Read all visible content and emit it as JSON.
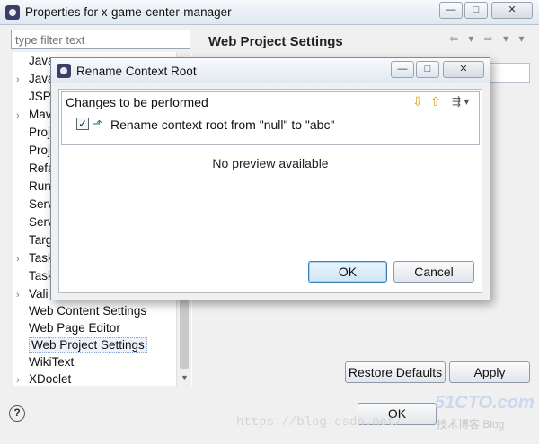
{
  "window": {
    "title": "Properties for x-game-center-manager",
    "minimize_glyph": "—",
    "maximize_glyph": "□",
    "close_glyph": "✕",
    "icon": "eclipse-icon"
  },
  "filter": {
    "placeholder": "type filter text"
  },
  "tree": {
    "items": [
      {
        "label": "Java",
        "arrow": ""
      },
      {
        "label": "Java",
        "arrow": "›"
      },
      {
        "label": "JSP",
        "arrow": ""
      },
      {
        "label": "Mav",
        "arrow": "›"
      },
      {
        "label": "Proj",
        "arrow": ""
      },
      {
        "label": "Proj",
        "arrow": ""
      },
      {
        "label": "Refa",
        "arrow": ""
      },
      {
        "label": "Run",
        "arrow": ""
      },
      {
        "label": "Serv",
        "arrow": ""
      },
      {
        "label": "Serv",
        "arrow": ""
      },
      {
        "label": "Targ",
        "arrow": ""
      },
      {
        "label": "Task",
        "arrow": "›"
      },
      {
        "label": "Task",
        "arrow": ""
      },
      {
        "label": "Vali",
        "arrow": "›"
      },
      {
        "label": "Web Content Settings",
        "arrow": ""
      },
      {
        "label": "Web Page Editor",
        "arrow": ""
      },
      {
        "label": "Web Project Settings",
        "arrow": "",
        "selected": true
      },
      {
        "label": "WikiText",
        "arrow": ""
      },
      {
        "label": "XDoclet",
        "arrow": "›"
      }
    ]
  },
  "right_panel": {
    "title": "Web Project Settings",
    "nav_glyphs": "⇦ ▾ ⇨ ▾ ▾",
    "restore_defaults_label": "Restore Defaults",
    "apply_label": "Apply"
  },
  "footer": {
    "help_glyph": "?",
    "ok_label": "OK",
    "watermark": "https://blog.csdn.net/",
    "logo_text": "51CTO.com",
    "logo_sub": "技术博客 Blog"
  },
  "dialog": {
    "title": "Rename Context Root",
    "minimize_glyph": "—",
    "maximize_glyph": "□",
    "close_glyph": "✕",
    "changes_header": "Changes to be performed",
    "toolbar_down_glyph": "⇩",
    "toolbar_up_glyph": "⇧",
    "toolbar_filter_glyph": "⇶ ▾",
    "change_checked_glyph": "✓",
    "change_text": "Rename context root from \"null\" to \"abc\"",
    "no_preview": "No preview available",
    "ok_label": "OK",
    "cancel_label": "Cancel"
  }
}
